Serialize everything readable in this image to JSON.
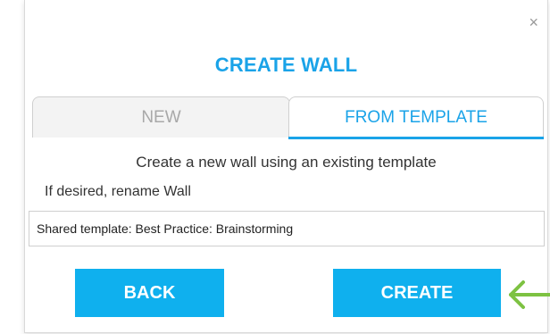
{
  "dialog": {
    "close_glyph": "×",
    "title": "CREATE WALL",
    "tabs": [
      {
        "label": "NEW",
        "active": false
      },
      {
        "label": "FROM TEMPLATE",
        "active": true
      }
    ],
    "description": "Create a new wall using an existing template",
    "rename_label": "If desired, rename Wall",
    "name_input_value": "Shared template: Best Practice: Brainstorming",
    "back_label": "BACK",
    "create_label": "CREATE"
  },
  "colors": {
    "accent": "#1aa3e8",
    "button": "#0fb0ee",
    "arrow": "#7dc242"
  },
  "icons": {
    "close": "close-icon",
    "pointer": "arrow-left-icon"
  }
}
